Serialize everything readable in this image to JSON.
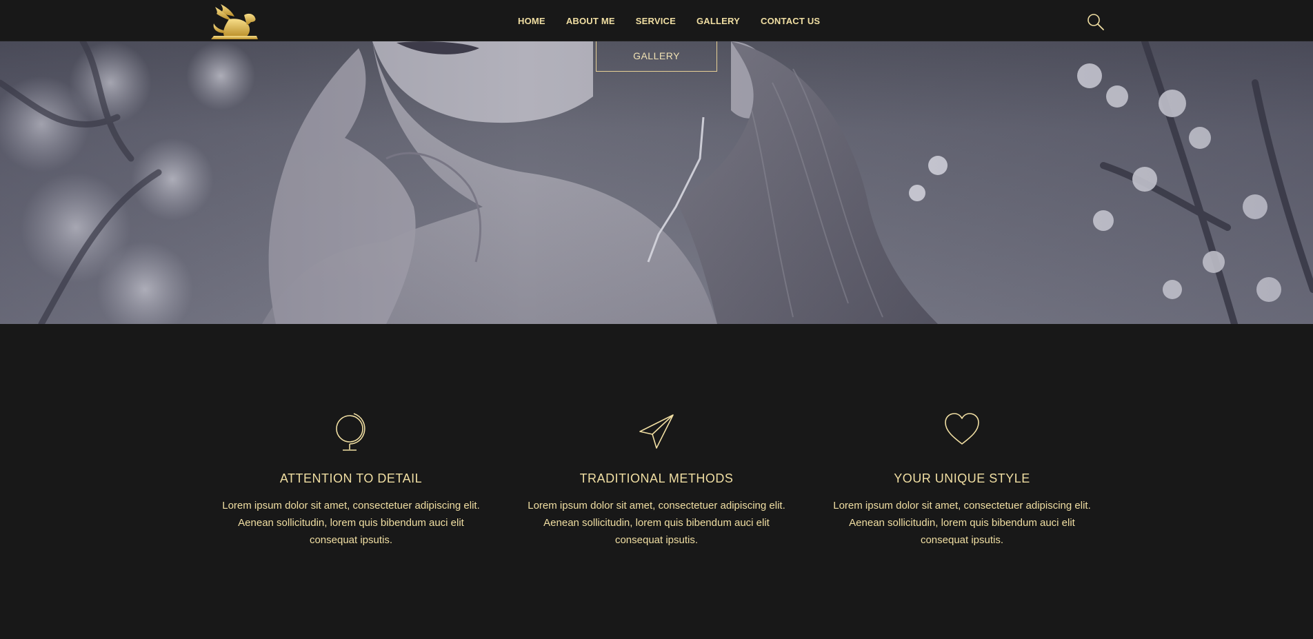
{
  "colors": {
    "accent": "#f1dfa3",
    "background": "#181818",
    "border_gold": "#e8d196"
  },
  "header": {
    "logo_icon": "griffin-logo-icon",
    "nav": [
      {
        "label": "HOME"
      },
      {
        "label": "ABOUT ME"
      },
      {
        "label": "SERVICE"
      },
      {
        "label": "GALLERY"
      },
      {
        "label": "CONTACT US"
      }
    ],
    "search_icon": "search-icon"
  },
  "hero": {
    "button_label": "GALLERY"
  },
  "features": [
    {
      "icon": "globe-icon",
      "title": "ATTENTION TO DETAIL",
      "text": "Lorem ipsum dolor sit amet, consectetuer adipiscing elit. Aenean sollicitudin, lorem quis bibendum auci elit consequat ipsutis."
    },
    {
      "icon": "paper-plane-icon",
      "title": "TRADITIONAL METHODS",
      "text": "Lorem ipsum dolor sit amet, consectetuer adipiscing elit. Aenean sollicitudin, lorem quis bibendum auci elit consequat ipsutis."
    },
    {
      "icon": "heart-icon",
      "title": "YOUR UNIQUE STYLE",
      "text": "Lorem ipsum dolor sit amet, consectetuer adipiscing elit. Aenean sollicitudin, lorem quis bibendum auci elit consequat ipsutis."
    }
  ]
}
